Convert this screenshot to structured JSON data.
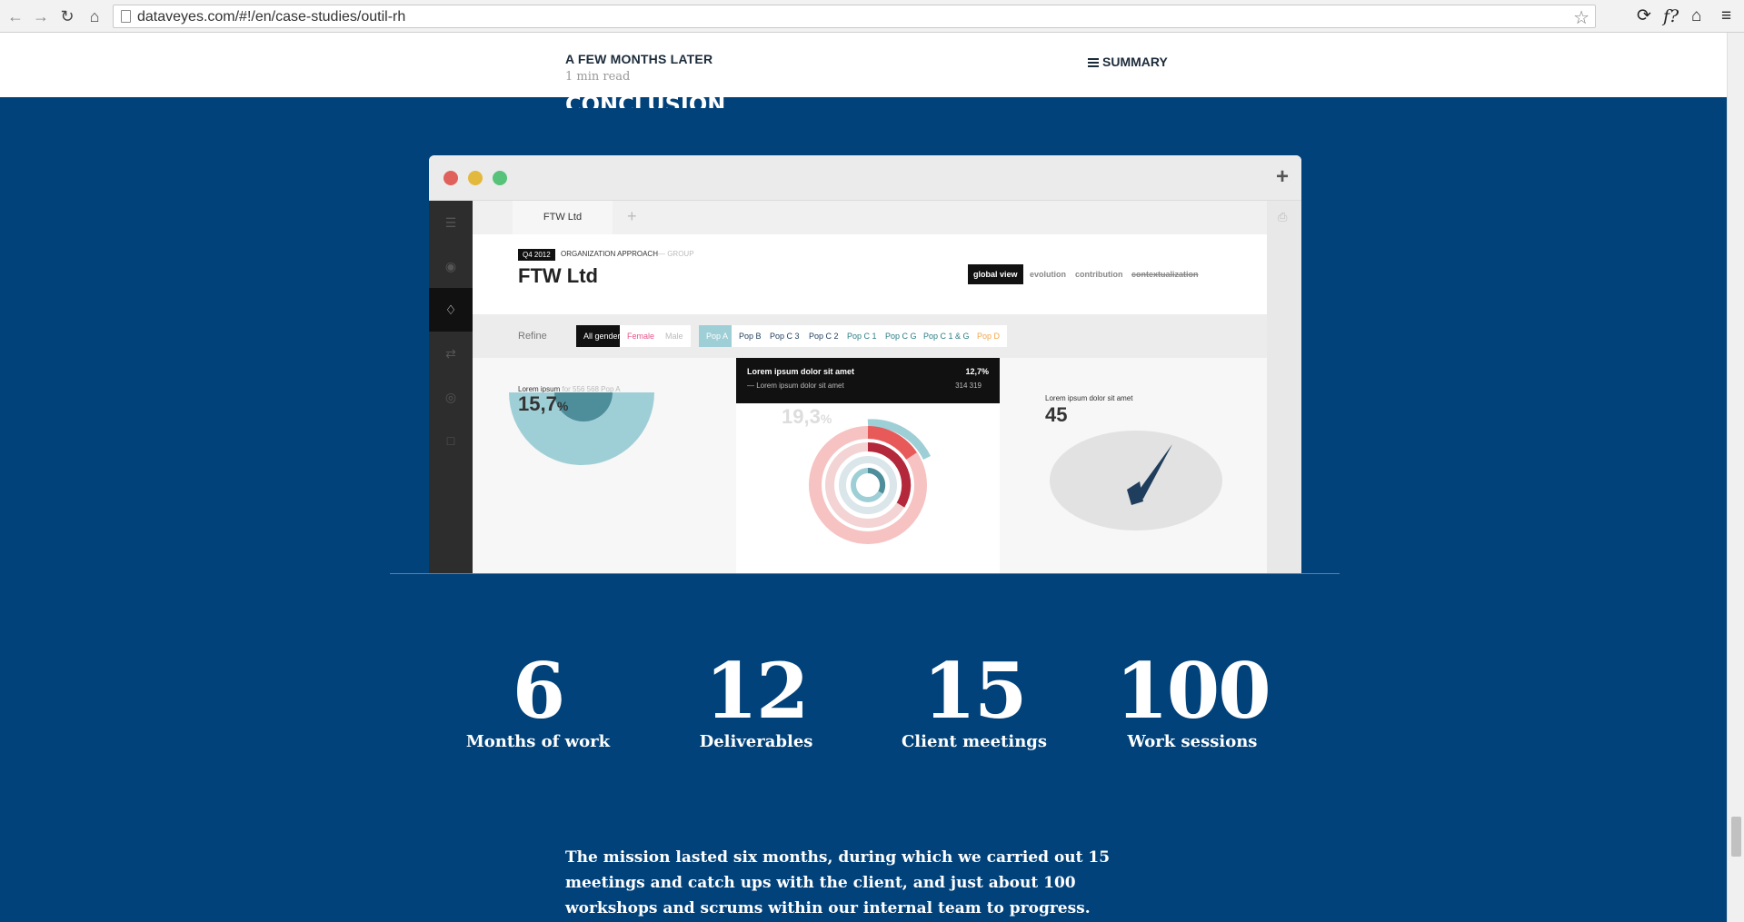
{
  "browser": {
    "url": "dataveyes.com/#!/en/case-studies/outil-rh",
    "back_icon": "arrow-left-icon",
    "forward_icon": "arrow-right-icon",
    "reload_icon": "reload-icon",
    "home_icon": "home-icon"
  },
  "header": {
    "section_title": "A FEW MONTHS LATER",
    "read_time": "1 min read",
    "summary_label": "SUMMARY"
  },
  "section_heading": "CONCLUSION",
  "mockup": {
    "tab_label": "FTW Ltd",
    "period_badge": "Q4 2012",
    "approach_label": "ORGANIZATION APPROACH",
    "approach_sub": "— GROUP",
    "company_name": "FTW Ltd",
    "view_tabs": [
      "global view",
      "evolution",
      "contribution",
      "contextualization"
    ],
    "refine_label": "Refine",
    "gender_chips": [
      "All gender",
      "Female",
      "Male"
    ],
    "pop_chips": [
      "Pop A",
      "Pop B",
      "Pop C 3",
      "Pop C 2",
      "Pop C 1",
      "Pop C G",
      "Pop C 1 & G",
      "Pop D"
    ],
    "left_panel": {
      "label": "Lorem ipsum",
      "sub": "for 556 568 Pop A",
      "value": "15,7",
      "unit": "%"
    },
    "mid_panel": {
      "value": "19,3",
      "unit": "%"
    },
    "right_panel": {
      "label": "Lorem ipsum dolor sit amet",
      "value": "45"
    },
    "tooltip": {
      "title": "Lorem ipsum dolor sit amet",
      "title_value": "12,7%",
      "sub": "— Lorem ipsum dolor sit amet",
      "sub_value": "314 319"
    },
    "colors": {
      "teal": "#9fcfd6",
      "dark_teal": "#4e8e9a",
      "red": "#b3283b",
      "pink": "#f6c2c2",
      "navy": "#1f3d5c"
    }
  },
  "stats": [
    {
      "number": "6",
      "label": "Months of work"
    },
    {
      "number": "12",
      "label": "Deliverables"
    },
    {
      "number": "15",
      "label": "Client meetings"
    },
    {
      "number": "100",
      "label": "Work sessions"
    }
  ],
  "paragraph": "The mission lasted six months, during which we carried out 15 meetings and catch ups with the client, and just about 100 workshops and scrums within our internal team to progress."
}
